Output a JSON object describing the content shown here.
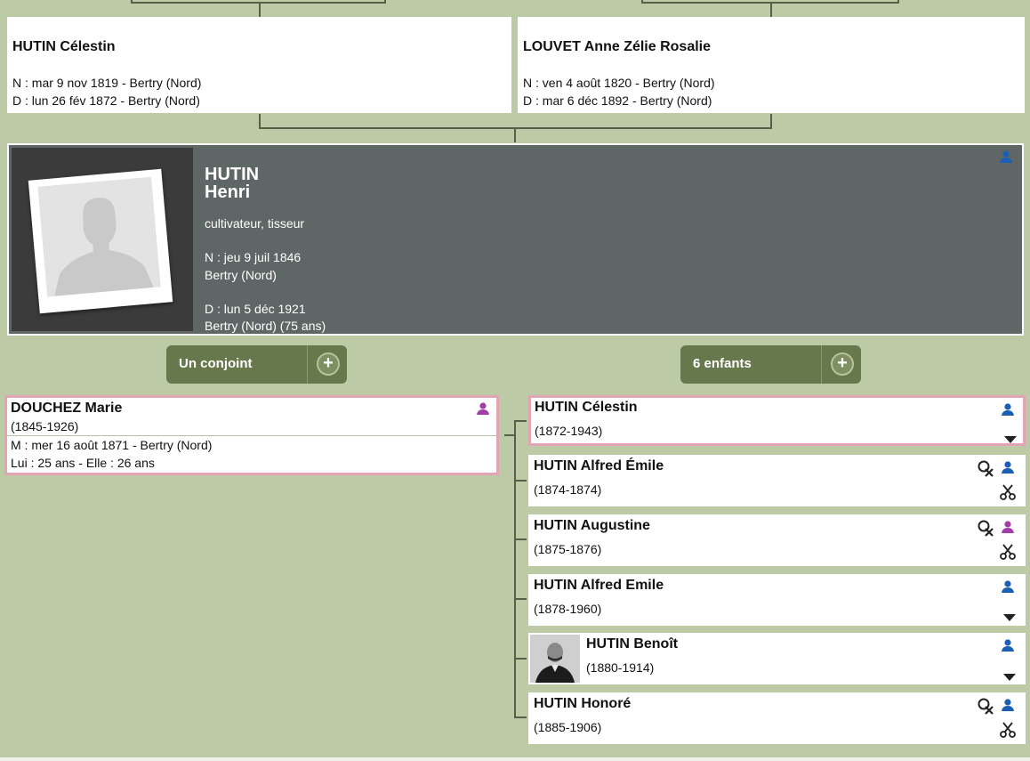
{
  "father": {
    "name": "HUTIN Célestin",
    "birth": "N : mar 9 nov 1819 - Bertry (Nord)",
    "death": "D : lun 26 fév 1872 - Bertry (Nord)"
  },
  "mother": {
    "name": "LOUVET Anne Zélie Rosalie",
    "birth": "N : ven 4 août 1820 - Bertry (Nord)",
    "death": "D : mar 6 déc 1892 - Bertry (Nord)"
  },
  "person": {
    "surname": "HUTIN",
    "given_name": "Henri",
    "occupation": "cultivateur, tisseur",
    "birth_date": "N : jeu 9 juil 1846",
    "birth_place": "Bertry (Nord)",
    "death_date": "D : lun 5 déc 1921",
    "death_place": "Bertry (Nord) (75 ans)"
  },
  "buttons": {
    "spouses_label": "Un conjoint",
    "children_label": "6 enfants",
    "plus": "+"
  },
  "spouse": {
    "name": "DOUCHEZ Marie",
    "years": "(1845-1926)",
    "marriage": "M : mer 16 août 1871 - Bertry (Nord)",
    "ages": "Lui : 25 ans - Elle : 26 ans"
  },
  "children": [
    {
      "name": "HUTIN Célestin",
      "years": "(1872-1943)",
      "gender": "male"
    },
    {
      "name": "HUTIN Alfred Émile",
      "years": "(1874-1874)",
      "gender": "male"
    },
    {
      "name": "HUTIN Augustine",
      "years": "(1875-1876)",
      "gender": "female"
    },
    {
      "name": "HUTIN Alfred Emile",
      "years": "(1878-1960)",
      "gender": "male"
    },
    {
      "name": "HUTIN Benoît",
      "years": "(1880-1914)",
      "gender": "male"
    },
    {
      "name": "HUTIN Honoré",
      "years": "(1885-1906)",
      "gender": "male"
    }
  ],
  "colors": {
    "background": "#bccba6",
    "main_card": "#5f6766",
    "button": "#67784d",
    "highlight_border": "#e4a4b4",
    "male_icon": "#1a5fb4",
    "female_icon": "#a23ea8"
  },
  "icons": [
    "person-icon",
    "female-person-icon",
    "search-cross-icon",
    "scissors-icon",
    "chevron-down-icon",
    "placeholder-silhouette",
    "child-photo"
  ]
}
